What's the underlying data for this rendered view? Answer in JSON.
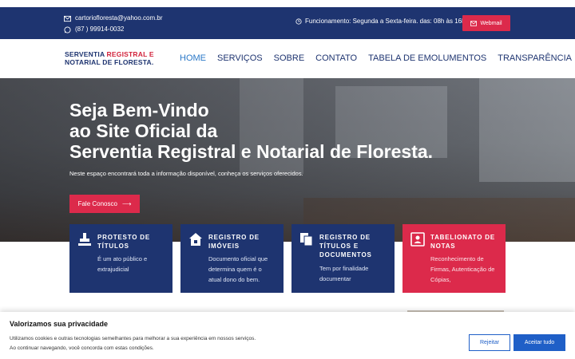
{
  "topbar": {
    "email": "cartorioflorest a@yahoo.com.br",
    "phone": "(87 ) 99914-0032",
    "hours": "Funcionamento: Segunda a Sexta-feira. das: 08h às 16h",
    "webmail_label": "Webmail"
  },
  "header": {
    "logo_line1_a": "SERVENTIA ",
    "logo_line1_b": "REGISTRAL E",
    "logo_line2": "NOTARIAL DE FLORESTA.",
    "nav": [
      {
        "label": "HOME"
      },
      {
        "label": "SERVIÇOS"
      },
      {
        "label": "SOBRE"
      },
      {
        "label": "CONTATO"
      },
      {
        "label": "TABELA DE EMOLUMENTOS"
      },
      {
        "label": "TRANSPARÊNCIA"
      }
    ]
  },
  "hero": {
    "line1": "Seja Bem-Vindo",
    "line2": "ao Site Oficial da",
    "line3": "Serventia Registral e Notarial de Floresta.",
    "subtitle": "Neste espaço encontrará toda a informação disponível, conheça os serviços oferecidos.",
    "cta_label": "Fale Conosco"
  },
  "cards": [
    {
      "title1": "PROTESTO DE",
      "title2": "TÍTULOS",
      "title3": "",
      "desc": [
        "É um ato público e",
        "extrajudicial"
      ],
      "icon": "stamp-icon"
    },
    {
      "title1": "REGISTRO DE",
      "title2": "IMÓVEIS",
      "title3": "",
      "desc": [
        "Documento oficial que",
        "determina quem é o",
        "atual dono do bem."
      ],
      "icon": "house-icon"
    },
    {
      "title1": "REGISTRO DE",
      "title2": "TÍTULOS E",
      "title3": "DOCUMENTOS",
      "desc": [
        "Tem por finalidade",
        "documentar"
      ],
      "icon": "documents-icon"
    },
    {
      "title1": "TABELIONATO DE",
      "title2": "NOTAS",
      "title3": "",
      "desc": [
        "Reconhecimento de",
        "Firmas, Autenticação de",
        "Cópias,"
      ],
      "icon": "id-card-icon"
    }
  ],
  "cookie": {
    "title": "Valorizamos sua privacidade",
    "text1": "Utilizamos cookies e outras tecnologias semelhantes para melhorar a sua experiência em nossos serviços.",
    "text2": "Ao continuar navegando, você concorda com estas condições.",
    "reject_label": "Rejeitar",
    "accept_label": "Aceitar tudo"
  },
  "colors": {
    "primary": "#1e3470",
    "accent": "#dc2a4b",
    "nav_active": "#2a78c8",
    "cookie_button": "#1f5fc7"
  }
}
